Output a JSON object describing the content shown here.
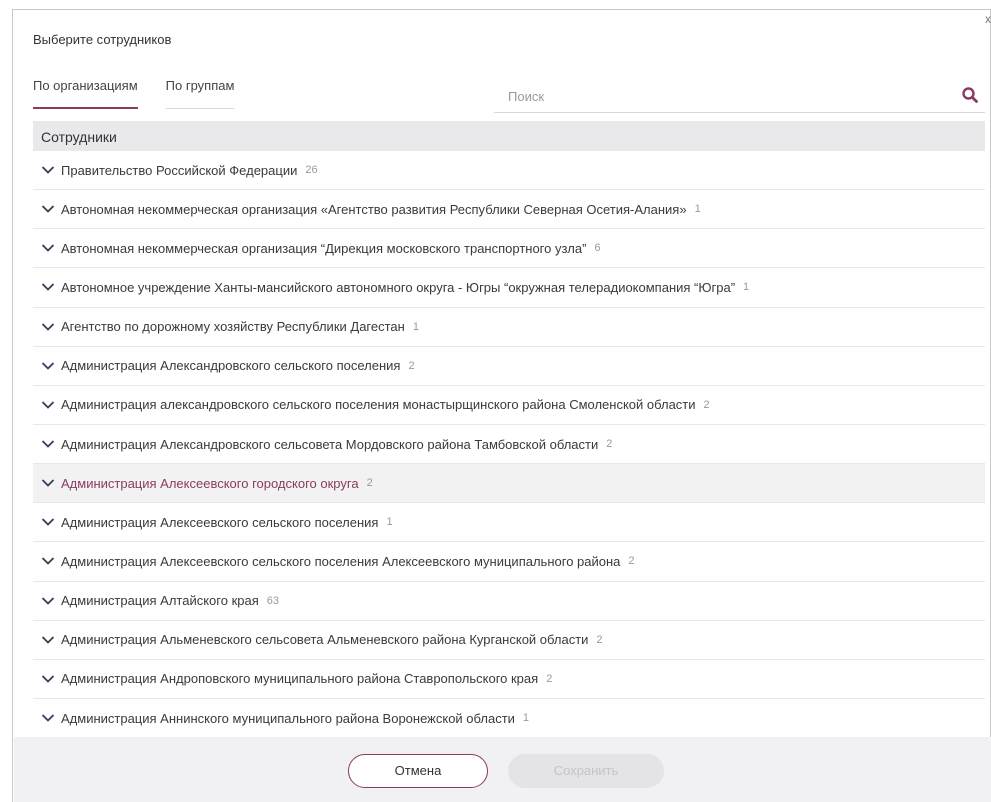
{
  "dialog": {
    "title": "Выберите сотрудников",
    "close_label": "x"
  },
  "tabs": [
    {
      "label": "По организациям",
      "active": true
    },
    {
      "label": "По группам",
      "active": false
    }
  ],
  "search": {
    "placeholder": "Поиск",
    "value": ""
  },
  "list": {
    "header": "Сотрудники",
    "items": [
      {
        "label": "Правительство Российской Федерации",
        "count": "26"
      },
      {
        "label": "Автономная некоммерческая организация «Агентство развития Республики Северная Осетия-Алания»",
        "count": "1"
      },
      {
        "label": "Автономная некоммерческая организация “Дирекция московского транспортного узла”",
        "count": "6"
      },
      {
        "label": "Автономное учреждение Ханты-мансийского автономного округа - Югры “окружная телерадиокомпания “Югра”",
        "count": "1"
      },
      {
        "label": "Агентство по дорожному хозяйству Республики Дагестан",
        "count": "1"
      },
      {
        "label": "Администрация Александровского сельского поселения",
        "count": "2"
      },
      {
        "label": "Администрация александровского сельского поселения монастырщинского района Смоленской области",
        "count": "2"
      },
      {
        "label": "Администрация Александровского сельсовета Мордовского района Тамбовской области",
        "count": "2"
      },
      {
        "label": "Администрация Алексеевского городского округа",
        "count": "2"
      },
      {
        "label": "Администрация Алексеевского сельского поселения",
        "count": "1"
      },
      {
        "label": "Администрация Алексеевского сельского поселения Алексеевского муниципального района",
        "count": "2"
      },
      {
        "label": "Администрация Алтайского края",
        "count": "63"
      },
      {
        "label": "Администрация Альменевского сельсовета Альменевского района Курганской области",
        "count": "2"
      },
      {
        "label": "Администрация Андроповского муниципального района Ставропольского края",
        "count": "2"
      },
      {
        "label": "Администрация Аннинского муниципального района Воронежской области",
        "count": "1"
      }
    ]
  },
  "footer": {
    "cancel_label": "Отмена",
    "save_label": "Сохранить"
  },
  "colors": {
    "accent": "#8a3b5f",
    "header_bg": "#e9e9ec",
    "footer_bg": "#f1f1f3",
    "count": "#999999"
  },
  "icons": {
    "search": "search-icon",
    "chevron": "chevron-down-icon",
    "close": "close-icon"
  }
}
